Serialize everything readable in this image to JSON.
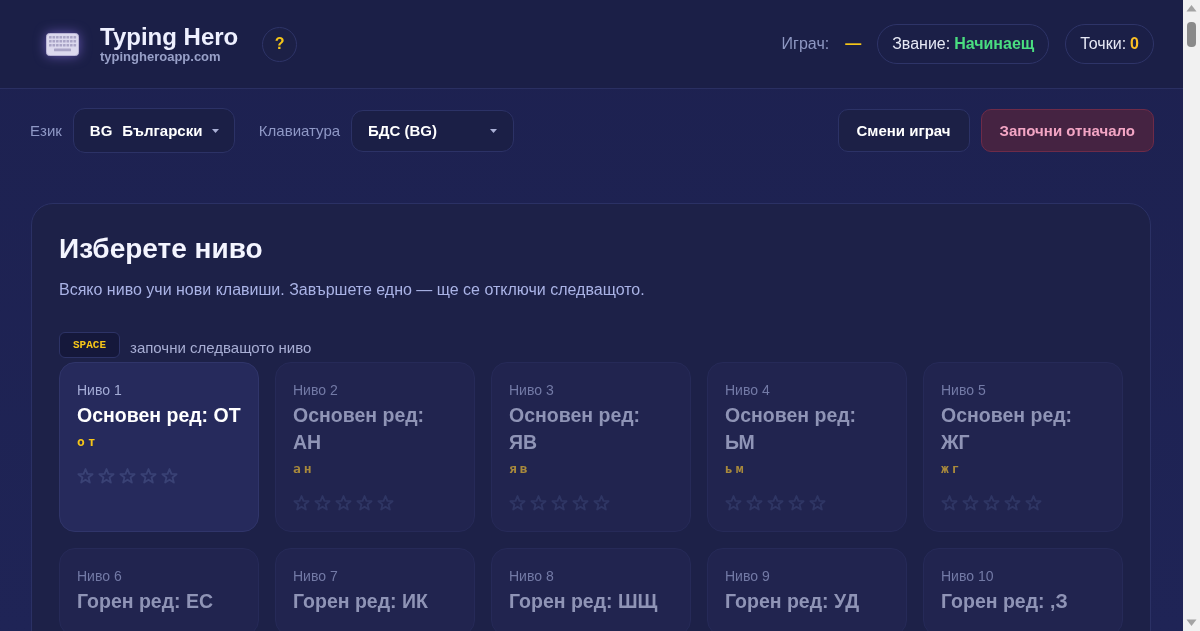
{
  "header": {
    "title": "Typing Hero",
    "subtitle": "typingheroapp.com",
    "help": "?",
    "player": {
      "label": "Играч:",
      "value": "—"
    },
    "rank": {
      "label": "Звание:",
      "value": "Начинаещ"
    },
    "points": {
      "label": "Точки:",
      "value": "0"
    }
  },
  "toolbar": {
    "language": {
      "label": "Език",
      "flag": "BG",
      "value": "Български"
    },
    "keyboard": {
      "label": "Клавиатура",
      "value": "БДС (BG)"
    },
    "buttons": [
      {
        "label": "Смени играч",
        "kind": "secondary"
      },
      {
        "label": "Започни отначало",
        "kind": "danger"
      }
    ]
  },
  "levels_panel": {
    "title": "Изберете ниво",
    "subtitle": "Всяко ниво учи нови клавиши. Завършете едно — ще се отключи следващото.",
    "hint": {
      "key": "SPACE",
      "text": "започни следващото ниво"
    },
    "levels": [
      {
        "label": "Ниво 1",
        "title": "Основен ред: ОТ",
        "keys": "от",
        "locked": false,
        "stars": 0
      },
      {
        "label": "Ниво 2",
        "title": "Основен ред: АН",
        "keys": "ан",
        "locked": true,
        "stars": 0
      },
      {
        "label": "Ниво 3",
        "title": "Основен ред: ЯВ",
        "keys": "яв",
        "locked": true,
        "stars": 0
      },
      {
        "label": "Ниво 4",
        "title": "Основен ред: ЬМ",
        "keys": "ьм",
        "locked": true,
        "stars": 0
      },
      {
        "label": "Ниво 5",
        "title": "Основен ред: ЖГ",
        "keys": "жг",
        "locked": true,
        "stars": 0
      },
      {
        "label": "Ниво 6",
        "title": "Горен ред: ЕС",
        "locked": true
      },
      {
        "label": "Ниво 7",
        "title": "Горен ред: ИК",
        "locked": true
      },
      {
        "label": "Ниво 8",
        "title": "Горен ред: ШЩ",
        "locked": true
      },
      {
        "label": "Ниво 9",
        "title": "Горен ред: УД",
        "locked": true
      },
      {
        "label": "Ниво 10",
        "title": "Горен ред: ,З",
        "locked": true
      }
    ]
  }
}
